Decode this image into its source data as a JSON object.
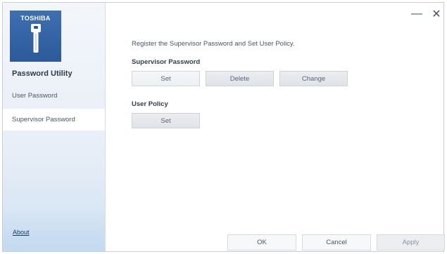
{
  "window": {
    "minimize_glyph": "—",
    "close_glyph": "✕"
  },
  "sidebar": {
    "brand": "TOSHIBA",
    "app_title": "Password Utility",
    "items": [
      {
        "label": "User Password"
      },
      {
        "label": "Supervisor Password"
      }
    ],
    "about_label": "About"
  },
  "main": {
    "intro": "Register the Supervisor Password and Set User Policy.",
    "supervisor_section": {
      "title": "Supervisor Password",
      "set_label": "Set",
      "delete_label": "Delete",
      "change_label": "Change"
    },
    "policy_section": {
      "title": "User Policy",
      "set_label": "Set"
    }
  },
  "footer": {
    "ok_label": "OK",
    "cancel_label": "Cancel",
    "apply_label": "Apply"
  },
  "colors": {
    "brand_blue": "#2c5a9a",
    "sidebar_bg": "#e8eef7",
    "accent_glow": "#c4daf0"
  }
}
